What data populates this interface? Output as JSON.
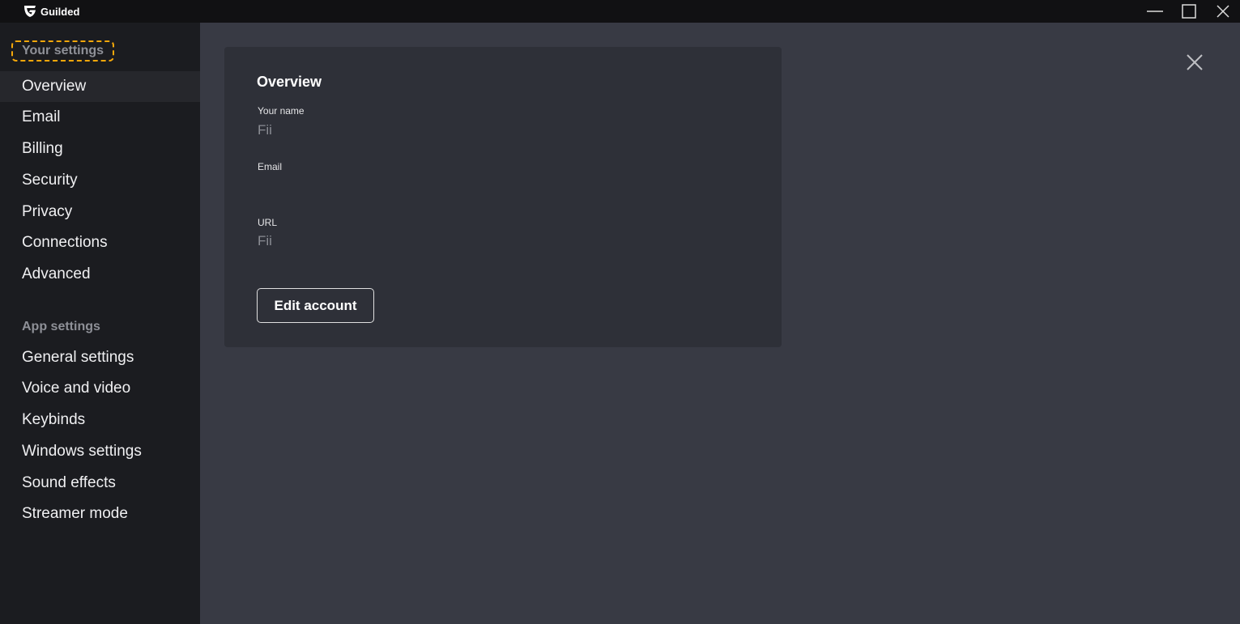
{
  "app": {
    "title": "Guilded",
    "icon": "guilded-logo-icon"
  },
  "window": {
    "minimize": "minimize-icon",
    "maximize": "maximize-icon",
    "close": "close-icon"
  },
  "sidebar": {
    "your_settings_label": "Your settings",
    "your_settings": [
      {
        "label": "Overview",
        "selected": true
      },
      {
        "label": "Email"
      },
      {
        "label": "Billing"
      },
      {
        "label": "Security"
      },
      {
        "label": "Privacy"
      },
      {
        "label": "Connections"
      },
      {
        "label": "Advanced"
      }
    ],
    "app_settings_label": "App settings",
    "app_settings": [
      {
        "label": "General settings"
      },
      {
        "label": "Voice and video"
      },
      {
        "label": "Keybinds"
      },
      {
        "label": "Windows settings"
      },
      {
        "label": "Sound effects"
      },
      {
        "label": "Streamer mode"
      }
    ]
  },
  "overview": {
    "title": "Overview",
    "name_label": "Your name",
    "name_value": "Fii",
    "email_label": "Email",
    "email_value": "",
    "url_label": "URL",
    "url_value": "Fii",
    "edit_button": "Edit account"
  },
  "colors": {
    "focus_outline": "#f5a70a"
  }
}
